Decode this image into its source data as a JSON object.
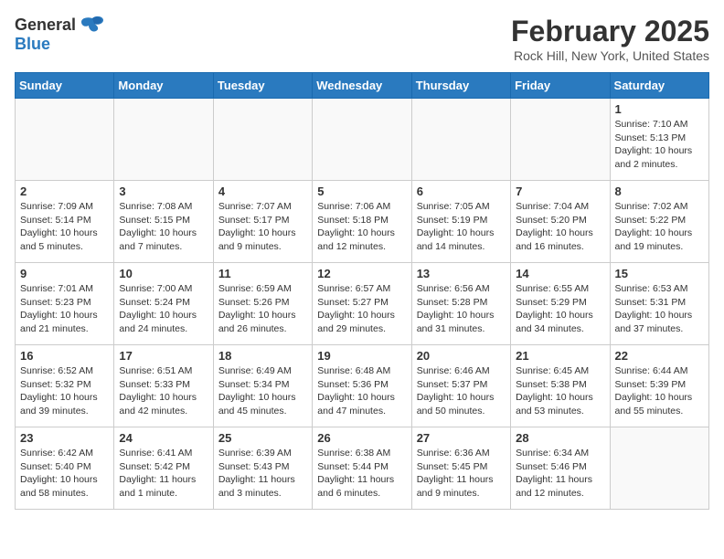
{
  "header": {
    "logo_general": "General",
    "logo_blue": "Blue",
    "title": "February 2025",
    "subtitle": "Rock Hill, New York, United States"
  },
  "days_of_week": [
    "Sunday",
    "Monday",
    "Tuesday",
    "Wednesday",
    "Thursday",
    "Friday",
    "Saturday"
  ],
  "weeks": [
    [
      {
        "day": "",
        "info": ""
      },
      {
        "day": "",
        "info": ""
      },
      {
        "day": "",
        "info": ""
      },
      {
        "day": "",
        "info": ""
      },
      {
        "day": "",
        "info": ""
      },
      {
        "day": "",
        "info": ""
      },
      {
        "day": "1",
        "info": "Sunrise: 7:10 AM\nSunset: 5:13 PM\nDaylight: 10 hours\nand 2 minutes."
      }
    ],
    [
      {
        "day": "2",
        "info": "Sunrise: 7:09 AM\nSunset: 5:14 PM\nDaylight: 10 hours\nand 5 minutes."
      },
      {
        "day": "3",
        "info": "Sunrise: 7:08 AM\nSunset: 5:15 PM\nDaylight: 10 hours\nand 7 minutes."
      },
      {
        "day": "4",
        "info": "Sunrise: 7:07 AM\nSunset: 5:17 PM\nDaylight: 10 hours\nand 9 minutes."
      },
      {
        "day": "5",
        "info": "Sunrise: 7:06 AM\nSunset: 5:18 PM\nDaylight: 10 hours\nand 12 minutes."
      },
      {
        "day": "6",
        "info": "Sunrise: 7:05 AM\nSunset: 5:19 PM\nDaylight: 10 hours\nand 14 minutes."
      },
      {
        "day": "7",
        "info": "Sunrise: 7:04 AM\nSunset: 5:20 PM\nDaylight: 10 hours\nand 16 minutes."
      },
      {
        "day": "8",
        "info": "Sunrise: 7:02 AM\nSunset: 5:22 PM\nDaylight: 10 hours\nand 19 minutes."
      }
    ],
    [
      {
        "day": "9",
        "info": "Sunrise: 7:01 AM\nSunset: 5:23 PM\nDaylight: 10 hours\nand 21 minutes."
      },
      {
        "day": "10",
        "info": "Sunrise: 7:00 AM\nSunset: 5:24 PM\nDaylight: 10 hours\nand 24 minutes."
      },
      {
        "day": "11",
        "info": "Sunrise: 6:59 AM\nSunset: 5:26 PM\nDaylight: 10 hours\nand 26 minutes."
      },
      {
        "day": "12",
        "info": "Sunrise: 6:57 AM\nSunset: 5:27 PM\nDaylight: 10 hours\nand 29 minutes."
      },
      {
        "day": "13",
        "info": "Sunrise: 6:56 AM\nSunset: 5:28 PM\nDaylight: 10 hours\nand 31 minutes."
      },
      {
        "day": "14",
        "info": "Sunrise: 6:55 AM\nSunset: 5:29 PM\nDaylight: 10 hours\nand 34 minutes."
      },
      {
        "day": "15",
        "info": "Sunrise: 6:53 AM\nSunset: 5:31 PM\nDaylight: 10 hours\nand 37 minutes."
      }
    ],
    [
      {
        "day": "16",
        "info": "Sunrise: 6:52 AM\nSunset: 5:32 PM\nDaylight: 10 hours\nand 39 minutes."
      },
      {
        "day": "17",
        "info": "Sunrise: 6:51 AM\nSunset: 5:33 PM\nDaylight: 10 hours\nand 42 minutes."
      },
      {
        "day": "18",
        "info": "Sunrise: 6:49 AM\nSunset: 5:34 PM\nDaylight: 10 hours\nand 45 minutes."
      },
      {
        "day": "19",
        "info": "Sunrise: 6:48 AM\nSunset: 5:36 PM\nDaylight: 10 hours\nand 47 minutes."
      },
      {
        "day": "20",
        "info": "Sunrise: 6:46 AM\nSunset: 5:37 PM\nDaylight: 10 hours\nand 50 minutes."
      },
      {
        "day": "21",
        "info": "Sunrise: 6:45 AM\nSunset: 5:38 PM\nDaylight: 10 hours\nand 53 minutes."
      },
      {
        "day": "22",
        "info": "Sunrise: 6:44 AM\nSunset: 5:39 PM\nDaylight: 10 hours\nand 55 minutes."
      }
    ],
    [
      {
        "day": "23",
        "info": "Sunrise: 6:42 AM\nSunset: 5:40 PM\nDaylight: 10 hours\nand 58 minutes."
      },
      {
        "day": "24",
        "info": "Sunrise: 6:41 AM\nSunset: 5:42 PM\nDaylight: 11 hours\nand 1 minute."
      },
      {
        "day": "25",
        "info": "Sunrise: 6:39 AM\nSunset: 5:43 PM\nDaylight: 11 hours\nand 3 minutes."
      },
      {
        "day": "26",
        "info": "Sunrise: 6:38 AM\nSunset: 5:44 PM\nDaylight: 11 hours\nand 6 minutes."
      },
      {
        "day": "27",
        "info": "Sunrise: 6:36 AM\nSunset: 5:45 PM\nDaylight: 11 hours\nand 9 minutes."
      },
      {
        "day": "28",
        "info": "Sunrise: 6:34 AM\nSunset: 5:46 PM\nDaylight: 11 hours\nand 12 minutes."
      },
      {
        "day": "",
        "info": ""
      }
    ]
  ]
}
